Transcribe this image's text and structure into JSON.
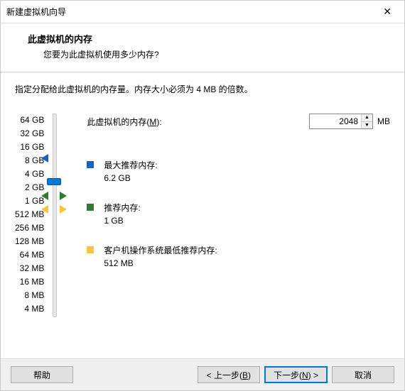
{
  "window": {
    "title": "新建虚拟机向导"
  },
  "header": {
    "title": "此虚拟机的内存",
    "subtitle": "您要为此虚拟机使用多少内存?"
  },
  "instruction": "指定分配给此虚拟机的内存量。内存大小必须为 4 MB 的倍数。",
  "memory": {
    "label_prefix": "此虚拟机的内存(",
    "label_hotkey": "M",
    "label_suffix": "):",
    "value": "2048",
    "unit": "MB"
  },
  "ticks": [
    "64 GB",
    "32 GB",
    "16 GB",
    "8 GB",
    "4 GB",
    "2 GB",
    "1 GB",
    "512 MB",
    "256 MB",
    "128 MB",
    "64 MB",
    "32 MB",
    "16 MB",
    "8 MB",
    "4 MB"
  ],
  "legend": {
    "max": {
      "label": "最大推荐内存:",
      "value": "6.2 GB"
    },
    "rec": {
      "label": "推荐内存:",
      "value": "1 GB"
    },
    "min": {
      "label": "客户机操作系统最低推荐内存:",
      "value": "512 MB"
    }
  },
  "buttons": {
    "help": "帮助",
    "back_prefix": "< 上一步(",
    "back_hotkey": "B",
    "back_suffix": ")",
    "next_prefix": "下一步(",
    "next_hotkey": "N",
    "next_suffix": ") >",
    "cancel": "取消"
  }
}
